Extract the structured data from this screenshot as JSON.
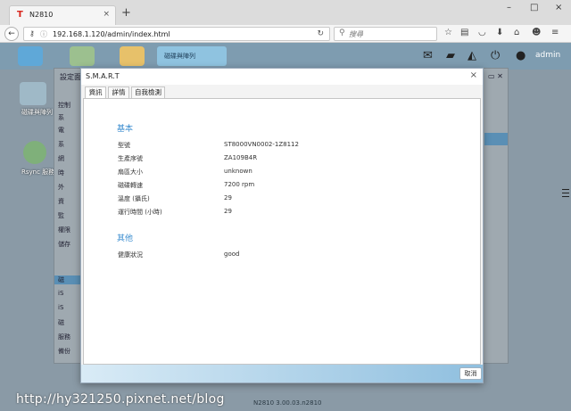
{
  "browser": {
    "tab_favicon": "T",
    "tab_title": "N2810",
    "tab_close": "×",
    "new_tab": "+",
    "url": "192.168.1.120/admin/index.html",
    "search_placeholder": "搜尋",
    "window_buttons": [
      "–",
      "□",
      "×"
    ],
    "icons": [
      "star-icon",
      "reading-list-icon",
      "pocket-icon",
      "download-icon",
      "home-icon",
      "smiley-icon",
      "menu-icon"
    ]
  },
  "nas": {
    "active_app_label": "磁碟與陣列",
    "user": "admin",
    "side_apps": [
      {
        "label": "磁碟與陣列"
      },
      {
        "label": "Rsync 服務"
      }
    ],
    "manager_title": "設定面",
    "manager_menu": [
      "控制",
      "系",
      "電",
      "系",
      "網",
      "時",
      "外",
      "資",
      "監",
      "權限",
      "儲存",
      "磁",
      "iS",
      "iS",
      "磁",
      "服務",
      "備份"
    ],
    "version_text": "N2810   3.00.03.n2810",
    "watermark": "http://hy321250.pixnet.net/blog"
  },
  "dialog": {
    "title": "S.M.A.R.T",
    "close": "×",
    "tabs": [
      "資訊",
      "詳情",
      "自我檢測"
    ],
    "section_basic": "基本",
    "fields": [
      {
        "label": "型號",
        "value": "ST8000VN0002-1Z8112"
      },
      {
        "label": "生產序號",
        "value": "ZA109B4R"
      },
      {
        "label": "扇區大小",
        "value": "unknown"
      },
      {
        "label": "磁碟轉速",
        "value": "7200 rpm"
      },
      {
        "label": "溫度 (攝氏)",
        "value": "29"
      },
      {
        "label": "運行時間 (小時)",
        "value": "29"
      }
    ],
    "section_other": "其他",
    "other_fields": [
      {
        "label": "健康狀況",
        "value": "good"
      }
    ],
    "cancel_label": "取消"
  },
  "colors": {
    "accent_blue": "#3d8ed0",
    "footer_gradient_end": "#8fbfdf",
    "favicon_red": "#d9251c"
  }
}
